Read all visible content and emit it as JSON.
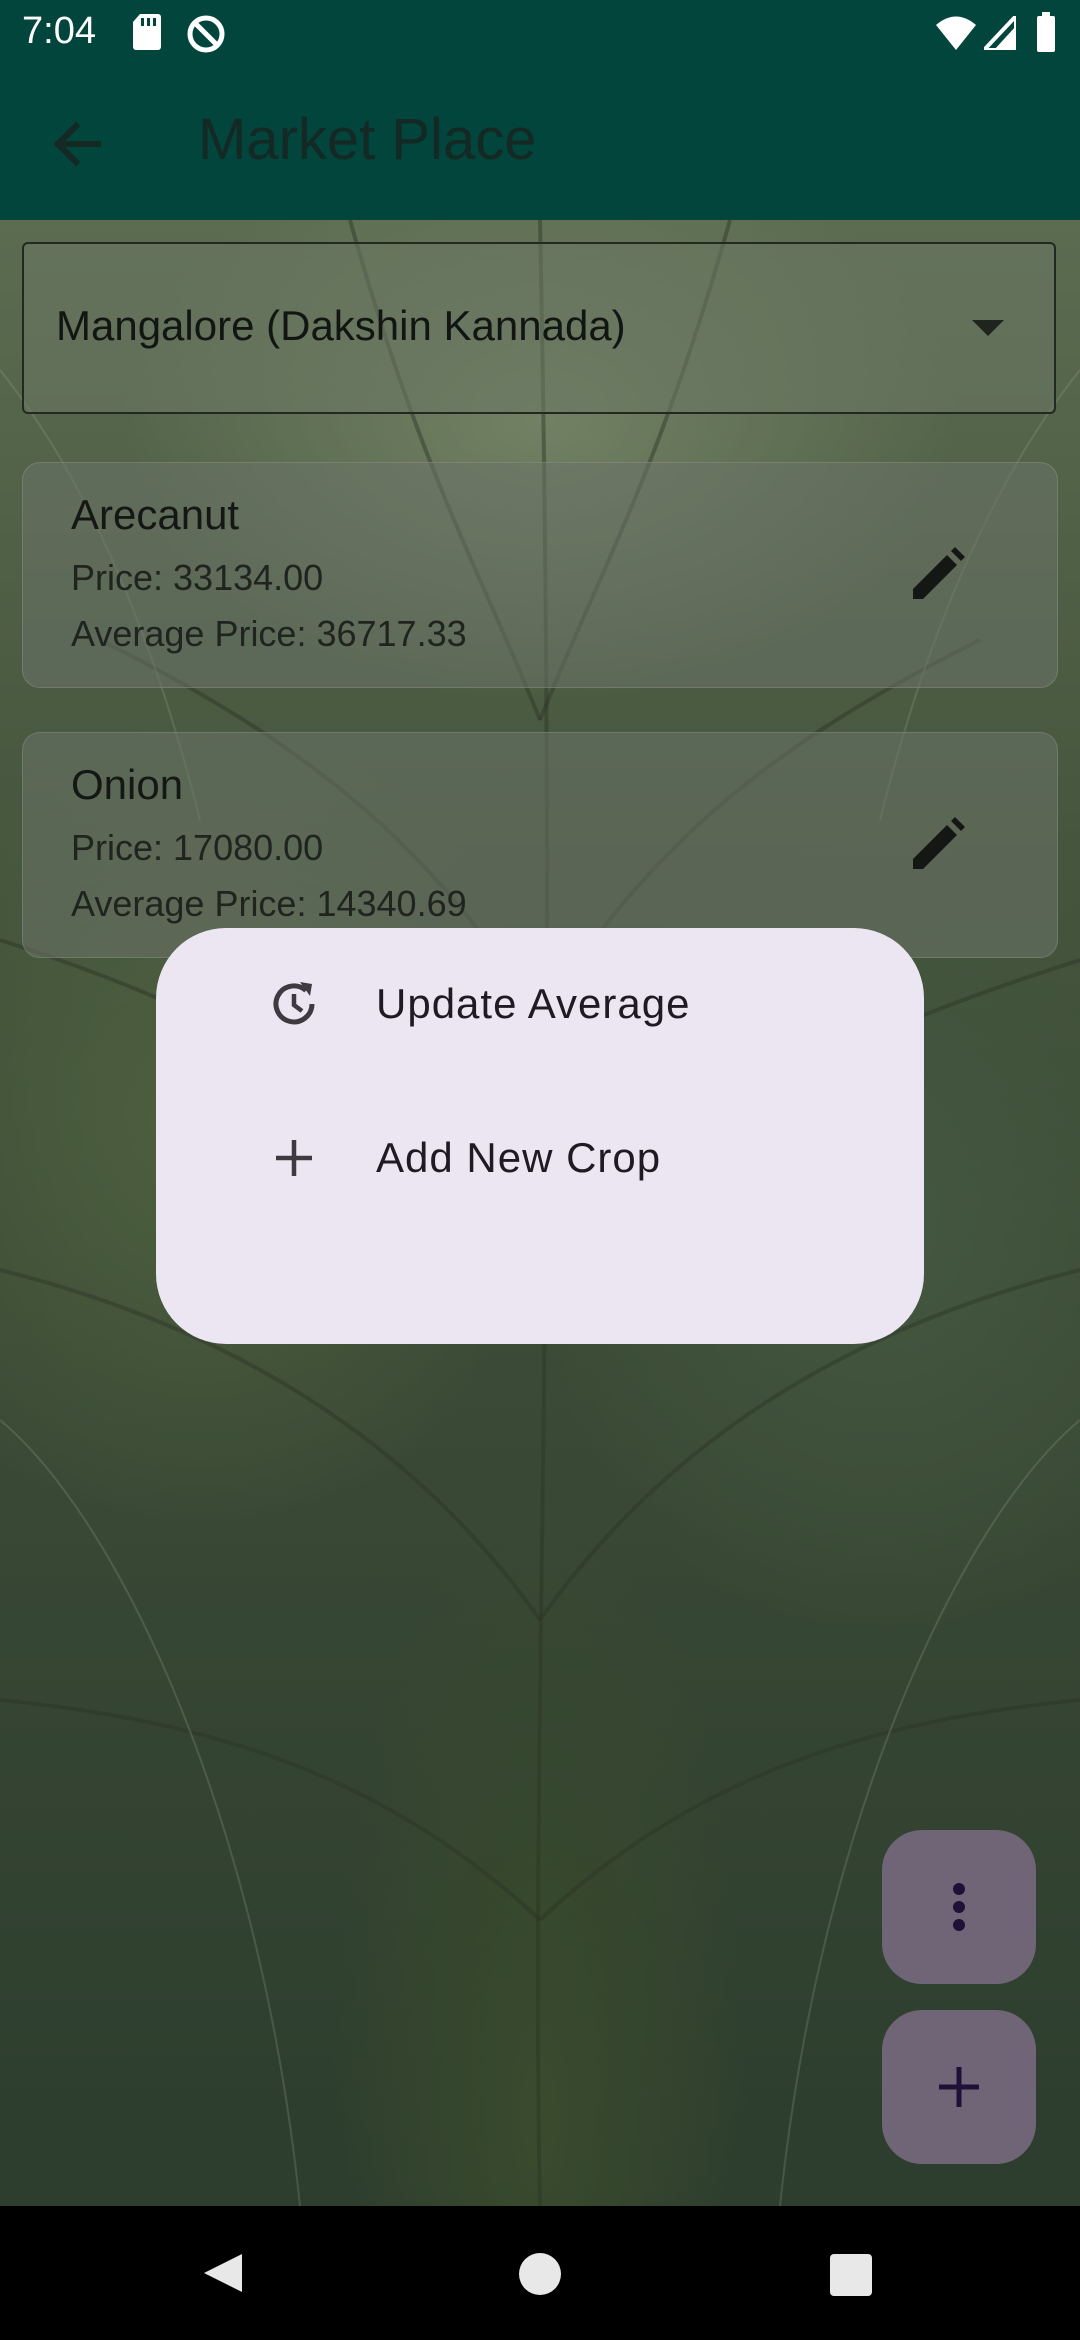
{
  "status_bar": {
    "time": "7:04",
    "left_icons": [
      "sd-card-icon",
      "sync-disabled-icon"
    ],
    "right_icons": [
      "wifi-icon",
      "cellular-signal-icon",
      "battery-icon"
    ]
  },
  "app_bar": {
    "title": "Market Place",
    "back_icon": "arrow-left-icon"
  },
  "region_dropdown": {
    "selected": "Mangalore (Dakshin Kannada)"
  },
  "crops": [
    {
      "name": "Arecanut",
      "price": "Price: 33134.00",
      "average": "Average Price: 36717.33"
    },
    {
      "name": "Onion",
      "price": "Price: 17080.00",
      "average": "Average Price: 14340.69"
    }
  ],
  "popup_menu": {
    "items": [
      {
        "label": "Update Average",
        "icon": "update-icon"
      },
      {
        "label": "Add New Crop",
        "icon": "plus-icon"
      }
    ]
  },
  "fabs": {
    "more_icon": "more-vert-icon",
    "add_icon": "plus-icon"
  },
  "colors": {
    "app_bar": "#02453d",
    "menu_bg": "#ece6f2",
    "fab_bg": "#6f6577",
    "fab_icon": "#1e1036"
  }
}
